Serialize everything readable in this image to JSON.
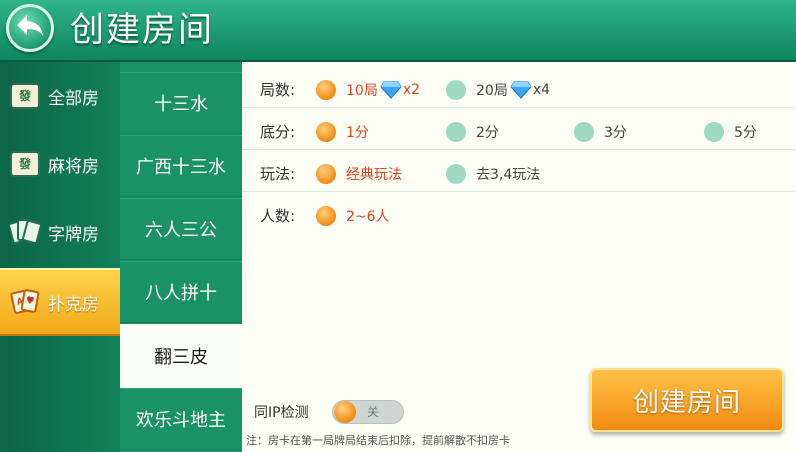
{
  "header": {
    "title": "创建房间",
    "back_icon": "back-arrow-icon"
  },
  "categories": [
    {
      "label": "全部房",
      "icon": "mahjong-tile-icon",
      "icon_text": "發"
    },
    {
      "label": "麻将房",
      "icon": "mahjong-tile-icon",
      "icon_text": "發"
    },
    {
      "label": "字牌房",
      "icon": "word-cards-icon"
    },
    {
      "label": "扑克房",
      "icon": "poker-cards-icon",
      "active": true
    }
  ],
  "games": [
    {
      "label": "十三水"
    },
    {
      "label": "广西十三水"
    },
    {
      "label": "六人三公"
    },
    {
      "label": "八人拼十"
    },
    {
      "label": "翻三皮",
      "active": true
    },
    {
      "label": "欢乐斗地主"
    }
  ],
  "options": {
    "rounds": {
      "label": "局数:",
      "choices": [
        {
          "text": "10局",
          "mult": "x2",
          "selected": true
        },
        {
          "text": "20局",
          "mult": "x4",
          "selected": false
        }
      ]
    },
    "base_score": {
      "label": "底分:",
      "choices": [
        {
          "text": "1分",
          "selected": true
        },
        {
          "text": "2分",
          "selected": false
        },
        {
          "text": "3分",
          "selected": false
        },
        {
          "text": "5分",
          "selected": false
        }
      ]
    },
    "play_mode": {
      "label": "玩法:",
      "choices": [
        {
          "text": "经典玩法",
          "selected": true
        },
        {
          "text": "去3,4玩法",
          "selected": false
        }
      ]
    },
    "players": {
      "label": "人数:",
      "choices": [
        {
          "text": "2~6人",
          "selected": true
        }
      ]
    }
  },
  "ip_check": {
    "label": "同IP检测",
    "toggle_text": "关",
    "on": false
  },
  "note": "注：房卡在第一局牌局结束后扣除，提前解散不扣房卡",
  "create_button": "创建房间",
  "colors": {
    "header_green": "#1f9a70",
    "selected_text": "#e2421c",
    "button_orange": "#f28a10",
    "active_category": "#f2a81a"
  }
}
